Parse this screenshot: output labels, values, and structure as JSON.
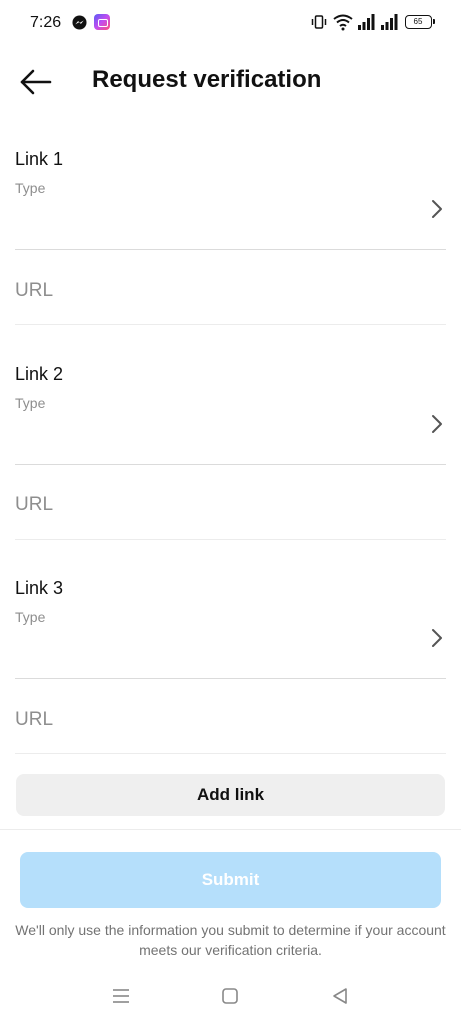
{
  "status_bar": {
    "time": "7:26",
    "battery": "65",
    "icons": [
      "messenger-icon",
      "app-icon",
      "vibrate-icon",
      "wifi-icon",
      "signal-icon",
      "signal-icon",
      "battery-icon"
    ]
  },
  "header": {
    "title": "Request verification",
    "back_icon": "arrow-left-icon"
  },
  "links": [
    {
      "heading": "Link 1",
      "type_label": "Type",
      "url_placeholder": "URL",
      "url_value": ""
    },
    {
      "heading": "Link 2",
      "type_label": "Type",
      "url_placeholder": "URL",
      "url_value": ""
    },
    {
      "heading": "Link 3",
      "type_label": "Type",
      "url_placeholder": "URL",
      "url_value": ""
    }
  ],
  "actions": {
    "add_link_label": "Add link",
    "submit_label": "Submit",
    "submit_enabled": false
  },
  "disclaimer": "We'll only use the information you submit to determine if your account meets our verification criteria.",
  "nav_bar": {
    "icons": [
      "menu-icon",
      "home-icon",
      "back-icon"
    ]
  },
  "colors": {
    "submit_disabled_bg": "#b5dffb",
    "add_link_bg": "#efefef",
    "secondary_text": "#8e8e8e",
    "divider": "#dbdbdb"
  }
}
